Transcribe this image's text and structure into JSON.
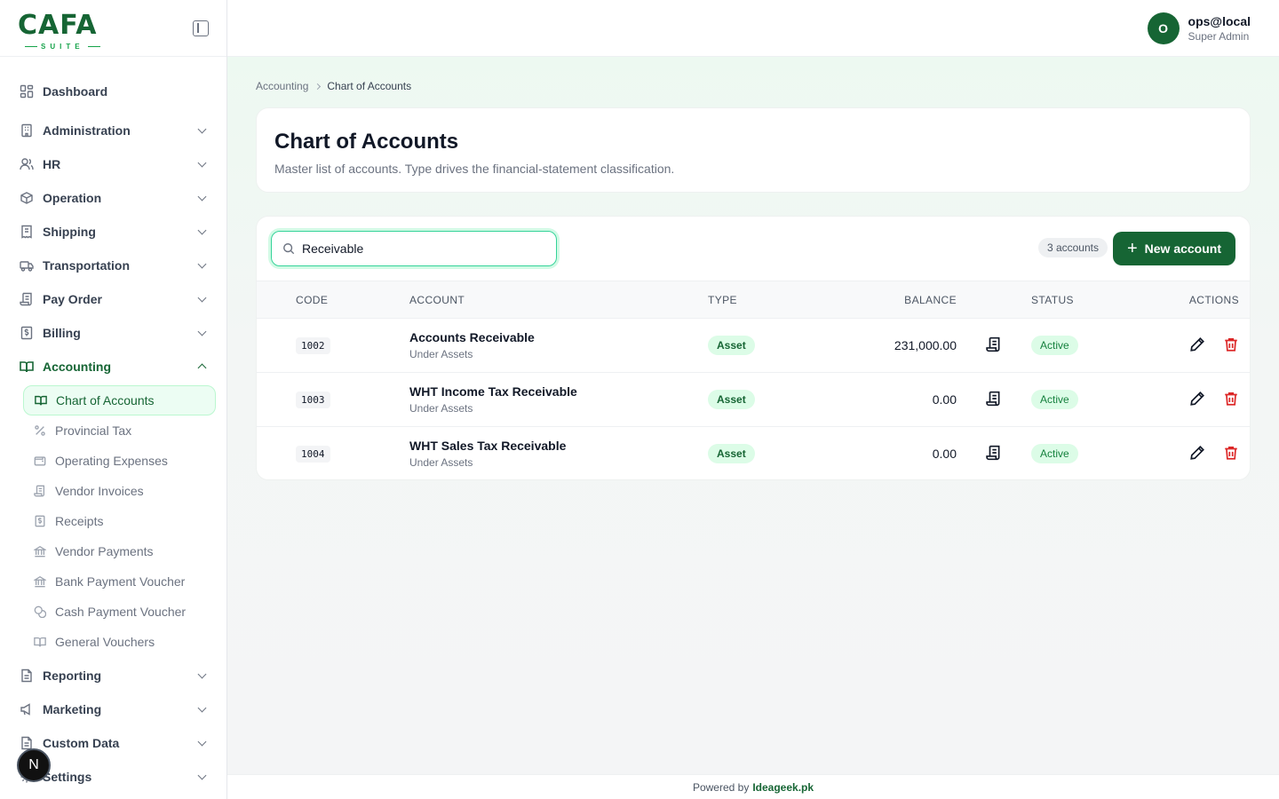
{
  "brand": {
    "logo_word": "CAFA",
    "logo_sub": "SUITE"
  },
  "sidebar": {
    "dashboard": "Dashboard",
    "groups": [
      {
        "label": "Administration",
        "icon": "building-icon"
      },
      {
        "label": "HR",
        "icon": "users-icon"
      },
      {
        "label": "Operation",
        "icon": "package-icon"
      },
      {
        "label": "Shipping",
        "icon": "receipt-icon"
      },
      {
        "label": "Transportation",
        "icon": "truck-icon"
      },
      {
        "label": "Pay Order",
        "icon": "scroll-icon"
      },
      {
        "label": "Billing",
        "icon": "dollar-receipt-icon"
      },
      {
        "label": "Accounting",
        "icon": "book-open-icon"
      }
    ],
    "accounting_items": [
      {
        "label": "Chart of Accounts",
        "icon": "book-open-icon",
        "active": true
      },
      {
        "label": "Provincial Tax",
        "icon": "percent-icon"
      },
      {
        "label": "Operating Expenses",
        "icon": "wallet-icon"
      },
      {
        "label": "Vendor Invoices",
        "icon": "scroll-icon"
      },
      {
        "label": "Receipts",
        "icon": "dollar-receipt-icon"
      },
      {
        "label": "Vendor Payments",
        "icon": "bank-icon"
      },
      {
        "label": "Bank Payment Voucher",
        "icon": "bank-icon"
      },
      {
        "label": "Cash Payment Voucher",
        "icon": "coins-icon"
      },
      {
        "label": "General Vouchers",
        "icon": "book-open-icon"
      }
    ],
    "lower_groups": [
      {
        "label": "Reporting",
        "icon": "file-icon"
      },
      {
        "label": "Marketing",
        "icon": "megaphone-icon"
      },
      {
        "label": "Custom Data",
        "icon": "file-icon"
      },
      {
        "label": "Settings",
        "icon": "gear-icon"
      }
    ],
    "floating_badge": "N"
  },
  "header": {
    "avatar_initial": "O",
    "user_name": "ops@local",
    "user_role": "Super Admin"
  },
  "breadcrumb": {
    "parent": "Accounting",
    "current": "Chart of Accounts"
  },
  "page": {
    "title": "Chart of Accounts",
    "subtitle": "Master list of accounts. Type drives the financial-statement classification."
  },
  "toolbar": {
    "search_value": "Receivable",
    "count_label": "3 accounts",
    "new_button": "New account"
  },
  "table": {
    "columns": [
      "CODE",
      "ACCOUNT",
      "TYPE",
      "BALANCE",
      "STATUS",
      "ACTIONS"
    ],
    "rows": [
      {
        "code": "1002",
        "name": "Accounts Receivable",
        "parent": "Under Assets",
        "type": "Asset",
        "balance": "231,000.00",
        "status": "Active"
      },
      {
        "code": "1003",
        "name": "WHT Income Tax Receivable",
        "parent": "Under Assets",
        "type": "Asset",
        "balance": "0.00",
        "status": "Active"
      },
      {
        "code": "1004",
        "name": "WHT Sales Tax Receivable",
        "parent": "Under Assets",
        "type": "Asset",
        "balance": "0.00",
        "status": "Active"
      }
    ]
  },
  "footer": {
    "prefix": "Powered by",
    "brand": "Ideageek.pk"
  }
}
